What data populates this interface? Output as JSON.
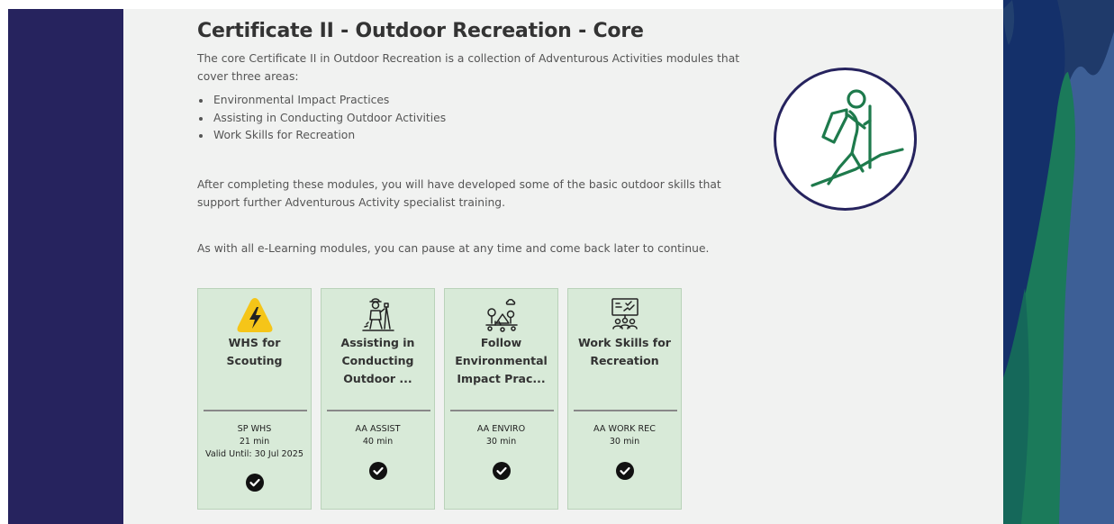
{
  "page": {
    "title": "Certificate II - Outdoor Recreation - Core",
    "intro": "The core Certificate II in Outdoor Recreation is a collection of Adventurous Activities modules that cover three areas:",
    "areas": [
      "Environmental Impact Practices",
      "Assisting in Conducting Outdoor Activities",
      "Work Skills for Recreation"
    ],
    "paragraph2": "After completing these modules, you will have developed some of the basic outdoor skills that support further Adventurous Activity specialist training.",
    "paragraph3": "As with all e-Learning modules, you can pause at any time and come back later to continue.",
    "hero_icon": "hiker-icon"
  },
  "colors": {
    "navy": "#26235e",
    "card_bg": "#d8ead8",
    "hero_green": "#1e7a4c",
    "content_bg": "#f1f2f1",
    "right_blue": "#3d5f96"
  },
  "modules": [
    {
      "title": "WHS for Scouting",
      "code": "SP WHS",
      "duration": "21 min",
      "valid_until": "Valid Until: 30 Jul 2025",
      "icon": "warning-lightning-icon",
      "status": "completed"
    },
    {
      "title": "Assisting in Conducting Outdoor ...",
      "code": "AA ASSIST",
      "duration": "40 min",
      "icon": "surveyor-icon",
      "status": "completed"
    },
    {
      "title": "Follow Environmental Impact Prac...",
      "code": "AA ENVIRO",
      "duration": "30 min",
      "icon": "camp-trees-icon",
      "status": "completed"
    },
    {
      "title": "Work Skills for Recreation",
      "code": "AA WORK REC",
      "duration": "30 min",
      "icon": "team-board-icon",
      "status": "completed"
    }
  ]
}
